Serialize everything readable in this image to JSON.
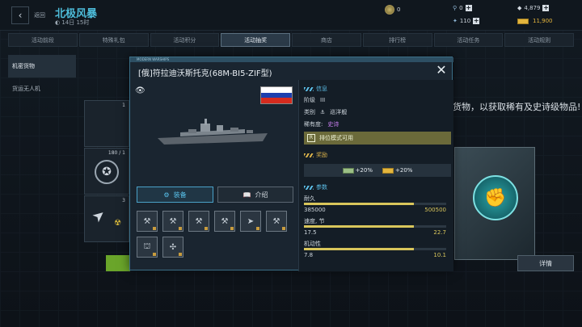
{
  "header": {
    "back_label": "返回",
    "title": "北极风暴",
    "date": "14日 15时",
    "resources": [
      {
        "icon": "crown-coin-icon",
        "value": "0"
      },
      {
        "icon": "wrench-icon",
        "value": "0"
      },
      {
        "icon": "oil-icon",
        "value": "4,879"
      },
      {
        "icon": "ammo-icon",
        "value": "110"
      },
      {
        "icon": "gold-bar-icon",
        "value": "11,900"
      }
    ]
  },
  "tabs": [
    "活动前段",
    "特殊礼包",
    "活动积分",
    "活动抽奖",
    "商店",
    "排行榜",
    "活动任务",
    "活动规则"
  ],
  "active_tab": "活动抽奖",
  "sidebar": {
    "items": [
      "机密货物",
      "货运无人机"
    ]
  },
  "cards": [
    {
      "num": "1"
    },
    {
      "num": "180 / 1"
    },
    {
      "num": "3"
    }
  ],
  "background": {
    "text": "货物，以获取稀有及史诗级物品!",
    "details_button": "详情"
  },
  "modal": {
    "tag": "MODERN WARSHIPS",
    "title": "[俄]符拉迪沃斯托克(68M-BI5-ZIF型)",
    "equip_button": "装备",
    "intro_button": "介绍",
    "info": {
      "section_title": "信息",
      "tier_label": "阶级",
      "tier_value": "III",
      "class_label": "类别",
      "class_value": "巡洋舰",
      "rarity_label": "稀有度:",
      "rarity_value": "史诗",
      "ranked_mode": "排位模式可用"
    },
    "rewards": {
      "section_title": "奖励",
      "items": [
        "+20%",
        "+20%"
      ]
    },
    "params": {
      "section_title": "参数",
      "stats": [
        {
          "label": "耐久",
          "value": "385000",
          "max": "500500",
          "fraction": 0.77
        },
        {
          "label": "速度, 节",
          "value": "17.5",
          "max": "22.7",
          "fraction": 0.77
        },
        {
          "label": "机动性",
          "value": "7.8",
          "max": "10.1",
          "fraction": 0.77
        }
      ]
    }
  },
  "colors": {
    "accent": "#4dbcd9",
    "epic": "#c87ef0",
    "gold": "#d9c65b"
  }
}
